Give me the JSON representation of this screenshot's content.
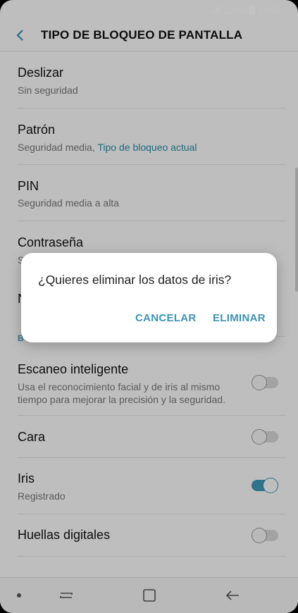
{
  "status_bar": {
    "battery_text": "100%",
    "time": "10:00"
  },
  "header": {
    "title": "TIPO DE BLOQUEO DE PANTALLA"
  },
  "list": {
    "deslizar": {
      "title": "Deslizar",
      "subtitle": "Sin seguridad"
    },
    "patron": {
      "title": "Patrón",
      "subtitle": "Seguridad media, ",
      "subtitle_accent": "Tipo de bloqueo actual"
    },
    "pin": {
      "title": "PIN",
      "subtitle": "Seguridad media a alta"
    },
    "contrasena": {
      "title": "Contraseña",
      "subtitle": "S"
    },
    "ninguno": {
      "title": "N"
    },
    "section": {
      "label": "B"
    },
    "escaneo": {
      "title": "Escaneo inteligente",
      "subtitle_line1": "Usa el reconocimiento facial y de iris al mismo",
      "subtitle_line2": "tiempo para mejorar la precisión y la seguridad.",
      "enabled": false
    },
    "cara": {
      "title": "Cara",
      "enabled": false
    },
    "iris": {
      "title": "Iris",
      "subtitle": "Registrado",
      "enabled": true
    },
    "huellas": {
      "title": "Huellas digitales",
      "enabled": false
    }
  },
  "dialog": {
    "message": "¿Quieres eliminar los datos de iris?",
    "cancel_label": "CANCELAR",
    "confirm_label": "ELIMINAR"
  },
  "colors": {
    "accent": "#3d92b5",
    "toggle_on": "#3f96b8"
  }
}
